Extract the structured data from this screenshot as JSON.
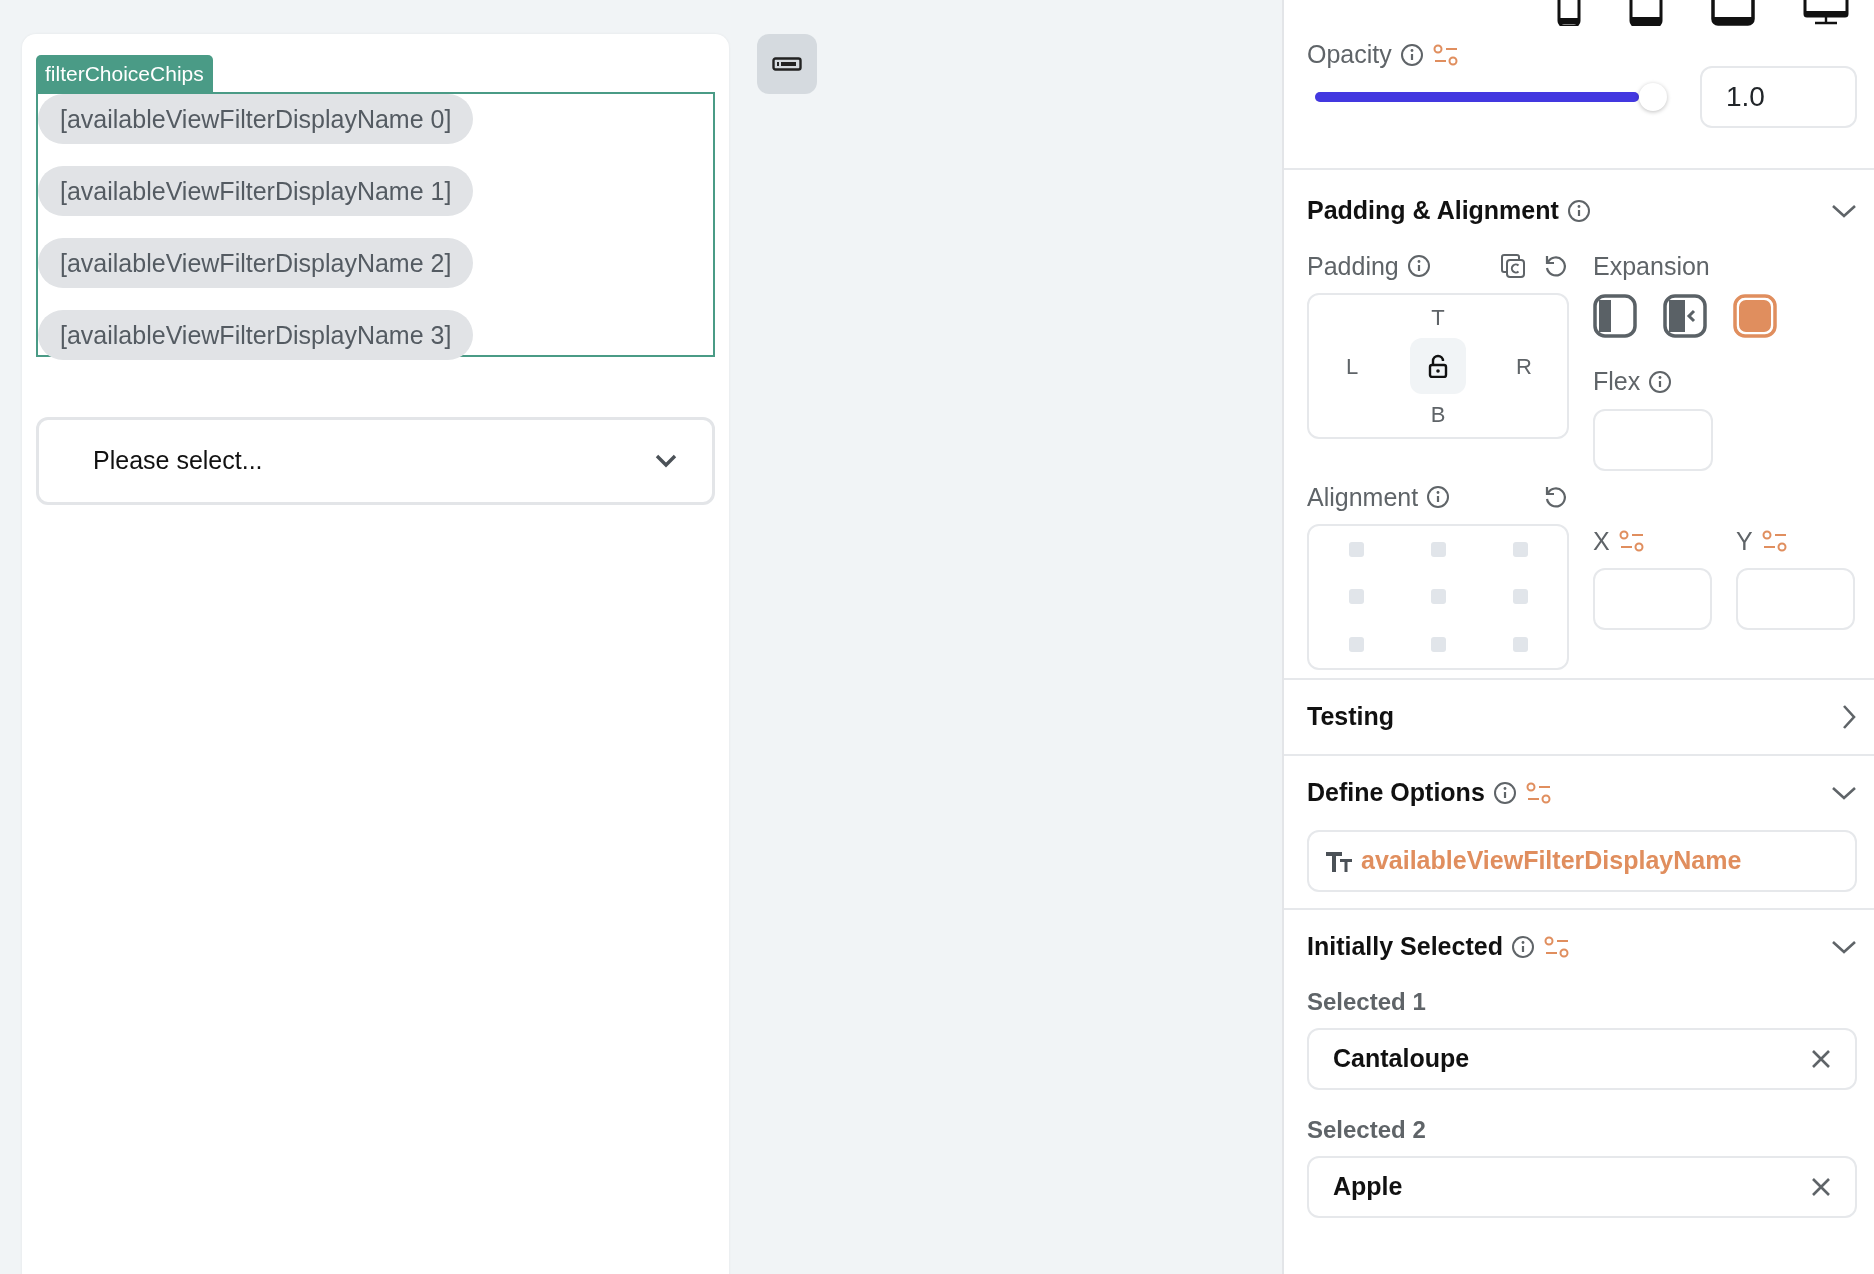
{
  "canvas": {
    "widget_tag": "filterChoiceChips",
    "chips": [
      {
        "label": "[availableViewFilterDisplayName 0]"
      },
      {
        "label": "[availableViewFilterDisplayName 1]"
      },
      {
        "label": "[availableViewFilterDisplayName 2]"
      },
      {
        "label": "[availableViewFilterDisplayName 3]"
      }
    ],
    "dropdown": {
      "placeholder": "Please select..."
    }
  },
  "panel": {
    "opacity": {
      "label": "Opacity",
      "level": 1,
      "value": "1.0"
    },
    "padding_alignment": {
      "title": "Padding & Alignment",
      "expanded": true,
      "padding": {
        "label": "Padding",
        "top": "T",
        "left": "L",
        "right": "R",
        "bottom": "B"
      },
      "expansion": {
        "label": "Expansion",
        "options": [
          {
            "kind": "fill",
            "selected": false
          },
          {
            "kind": "shrink",
            "selected": false
          },
          {
            "kind": "flex",
            "selected": true
          }
        ]
      },
      "flex": {
        "label": "Flex"
      },
      "alignment": {
        "label": "Alignment"
      },
      "x": {
        "label": "X"
      },
      "y": {
        "label": "Y"
      }
    },
    "testing": {
      "title": "Testing",
      "expanded": false
    },
    "define_options": {
      "title": "Define Options",
      "expanded": true,
      "value": "availableViewFilterDisplayName"
    },
    "initially_selected": {
      "title": "Initially Selected",
      "expanded": true,
      "items": [
        {
          "label": "Selected 1",
          "value": "Cantaloupe"
        },
        {
          "label": "Selected 2",
          "value": "Apple"
        }
      ]
    }
  }
}
